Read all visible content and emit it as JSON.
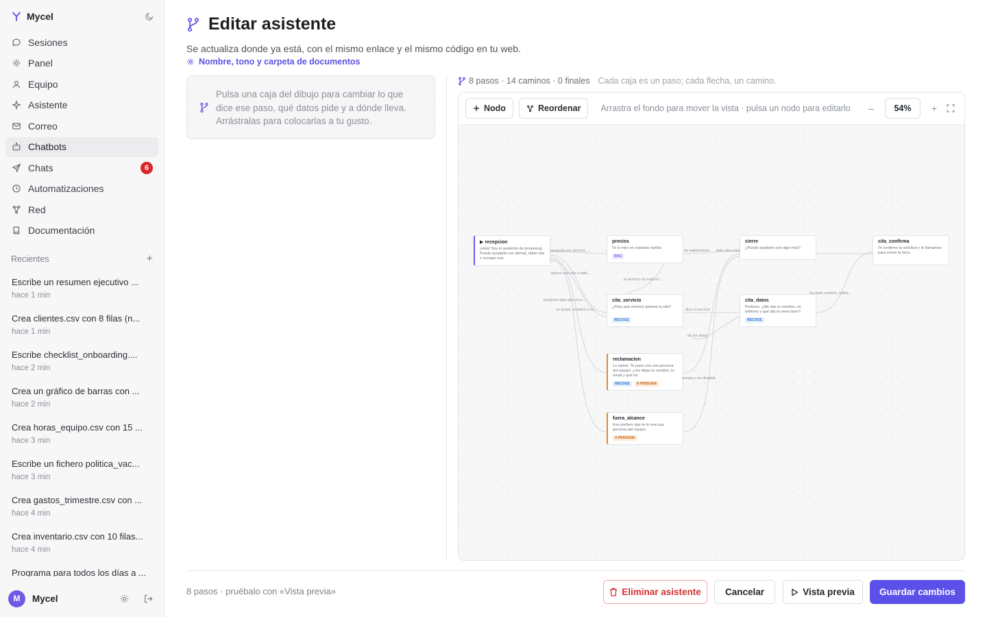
{
  "app": {
    "name": "Mycel"
  },
  "sidebar": {
    "items": [
      {
        "label": "Sesiones",
        "icon": "chat-bubble-icon"
      },
      {
        "label": "Panel",
        "icon": "gear-icon"
      },
      {
        "label": "Equipo",
        "icon": "user-icon"
      },
      {
        "label": "Asistente",
        "icon": "sparkle-icon"
      },
      {
        "label": "Correo",
        "icon": "mail-icon"
      },
      {
        "label": "Chatbots",
        "icon": "bot-icon",
        "active": true
      },
      {
        "label": "Chats",
        "icon": "send-icon",
        "badge": "6"
      },
      {
        "label": "Automatizaciones",
        "icon": "clock-icon"
      },
      {
        "label": "Red",
        "icon": "network-icon"
      },
      {
        "label": "Documentación",
        "icon": "book-icon"
      }
    ],
    "recents_label": "Recientes",
    "recents": [
      {
        "title": "Escribe un resumen ejecutivo ...",
        "time": "hace 1 min"
      },
      {
        "title": "Crea clientes.csv con 8 filas (n...",
        "time": "hace 1 min"
      },
      {
        "title": "Escribe checklist_onboarding....",
        "time": "hace 2 min"
      },
      {
        "title": "Crea un gráfico de barras con ...",
        "time": "hace 2 min"
      },
      {
        "title": "Crea horas_equipo.csv con 15 ...",
        "time": "hace 3 min"
      },
      {
        "title": "Escribe un fichero politica_vac...",
        "time": "hace 3 min"
      },
      {
        "title": "Crea gastos_trimestre.csv con ...",
        "time": "hace 4 min"
      },
      {
        "title": "Crea inventario.csv con 10 filas...",
        "time": "hace 4 min"
      },
      {
        "title": "Programa para todos los días a ...",
        "time": ""
      }
    ],
    "user": {
      "initial": "M",
      "name": "Mycel"
    }
  },
  "main": {
    "title": "Editar asistente",
    "subtitle": "Se actualiza donde ya está, con el mismo enlace y el mismo código en tu web.",
    "settings_link": "Nombre, tono y carpeta de documentos",
    "hint": "Pulsa una caja del dibujo para cambiar lo que dice ese paso, qué datos pide y a dónde lleva. Arrástralas para colocarlas a tu gusto.",
    "stats": "8 pasos · 14 caminos · 0 finales",
    "stats_hint": "Cada caja es un paso; cada flecha, un camino."
  },
  "editor": {
    "add_node": "Nodo",
    "reorder": "Reordenar",
    "hint": "Arrastra el fondo para mover la vista · pulsa un nodo para editarlo",
    "zoom": "54%",
    "zoom_out": "–",
    "zoom_in": "+"
  },
  "graph": {
    "nodes": [
      {
        "id": "recepcion",
        "title": "▶ recepcion",
        "text": "¡Hola! Soy el asistente de {empresa}. Puedo ayudarte con {tema}, darte cita o recoger una",
        "tags": []
      },
      {
        "id": "precios",
        "title": "precios",
        "text": "Te lo miro en nuestras tarifas.",
        "tags": [
          "RAG"
        ]
      },
      {
        "id": "cierre",
        "title": "cierre",
        "text": "¿Puedo ayudarte con algo más?",
        "tags": []
      },
      {
        "id": "cita_confirma",
        "title": "cita_confirma",
        "text": "Te confirmo la solicitud y te llamamos para cerrar la hora.",
        "tags": []
      },
      {
        "id": "cita_servicio",
        "title": "cita_servicio",
        "text": "¿Para qué servicio quieres la cita?",
        "tags": [
          "RECOGE"
        ]
      },
      {
        "id": "cita_datos",
        "title": "cita_datos",
        "text": "Perfecto. ¿Me das tu nombre, un teléfono y qué día te viene bien?",
        "tags": [
          "RECOGE"
        ]
      },
      {
        "id": "reclamacion",
        "title": "reclamacion",
        "text": "Lo siento. Te paso con una persona del equipo: ¿me dejas tu nombre, tu email y qué ha",
        "tags": [
          "RECOGE",
          "A PERSONA"
        ]
      },
      {
        "id": "fuera_alcance",
        "title": "fuera_alcance",
        "text": "Eso prefiero que te lo vea una persona del equipo.",
        "tags": [
          "A PERSONA"
        ]
      }
    ],
    "edge_labels": [
      "pregunta por precios, ...",
      "quiere una cita o habl...",
      "pregunta algo que no e...",
      "se queja, reclama o es...",
      "el servicio no está en...",
      "da satisfecho/a",
      "pide otra cosa",
      "dice el servicio",
      "da los datos",
      "ha dado nombre, teléfo...",
      "acepta o se despide"
    ]
  },
  "footer": {
    "info": "8 pasos · pruébalo con «Vista previa»",
    "delete": "Eliminar asistente",
    "cancel": "Cancelar",
    "preview": "Vista previa",
    "save": "Guardar cambios"
  },
  "colors": {
    "accent": "#5b50e8",
    "danger": "#dc2626",
    "human": "#e08a2b"
  }
}
